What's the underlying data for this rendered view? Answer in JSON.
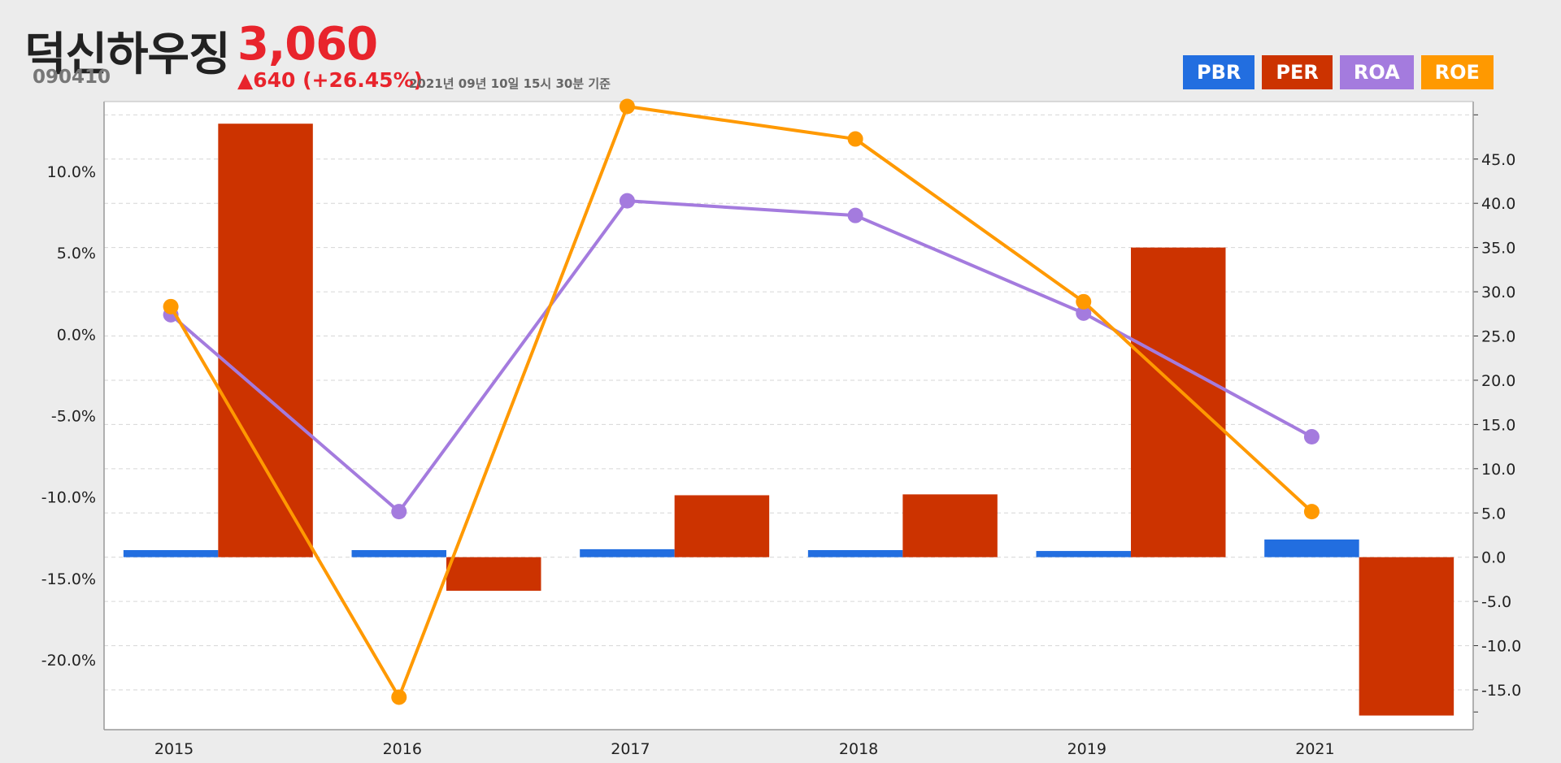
{
  "header": {
    "company_name": "덕신하우징",
    "price": "3,060",
    "code": "090410",
    "change": "▲640 (+26.45%)",
    "as_of": "2021년 09년 10일 15시 30분 기준"
  },
  "legend": [
    {
      "label": "PBR",
      "color": "#226ee0"
    },
    {
      "label": "PER",
      "color": "#cc3300"
    },
    {
      "label": "ROA",
      "color": "#a47bde"
    },
    {
      "label": "ROE",
      "color": "#ff9900"
    }
  ],
  "chart_data": {
    "type": "bar+line",
    "categories": [
      "2015",
      "2016",
      "2017",
      "2018",
      "2019",
      "2021"
    ],
    "left_axis": {
      "unit": "%",
      "ticks": [
        "10.0%",
        "5.0%",
        "0.0%",
        "-5.0%",
        "-10.0%",
        "-15.0%",
        "-20.0%"
      ],
      "range": [
        -24.3,
        14.3
      ]
    },
    "right_axis": {
      "ticks": [
        "45.0",
        "40.0",
        "35.0",
        "30.0",
        "25.0",
        "20.0",
        "15.0",
        "10.0",
        "5.0",
        "0.0",
        "-5.0",
        "-10.0",
        "-15.0"
      ],
      "range": [
        -19.5,
        51.5
      ]
    },
    "series": [
      {
        "name": "PBR",
        "type": "bar",
        "axis": "right",
        "color": "#226ee0",
        "values": [
          0.8,
          0.8,
          0.9,
          0.8,
          0.7,
          2.0
        ]
      },
      {
        "name": "PER",
        "type": "bar",
        "axis": "right",
        "color": "#cc3300",
        "values": [
          49.0,
          -3.8,
          7.0,
          7.1,
          35.0,
          -17.9
        ]
      },
      {
        "name": "ROA",
        "type": "line",
        "axis": "left",
        "color": "#a47bde",
        "values": [
          1.2,
          -10.9,
          8.2,
          7.3,
          1.3,
          -6.3
        ]
      },
      {
        "name": "ROE",
        "type": "line",
        "axis": "left",
        "color": "#ff9900",
        "values": [
          1.7,
          -22.3,
          14.0,
          12.0,
          2.0,
          -10.9
        ]
      }
    ],
    "grid": true
  }
}
